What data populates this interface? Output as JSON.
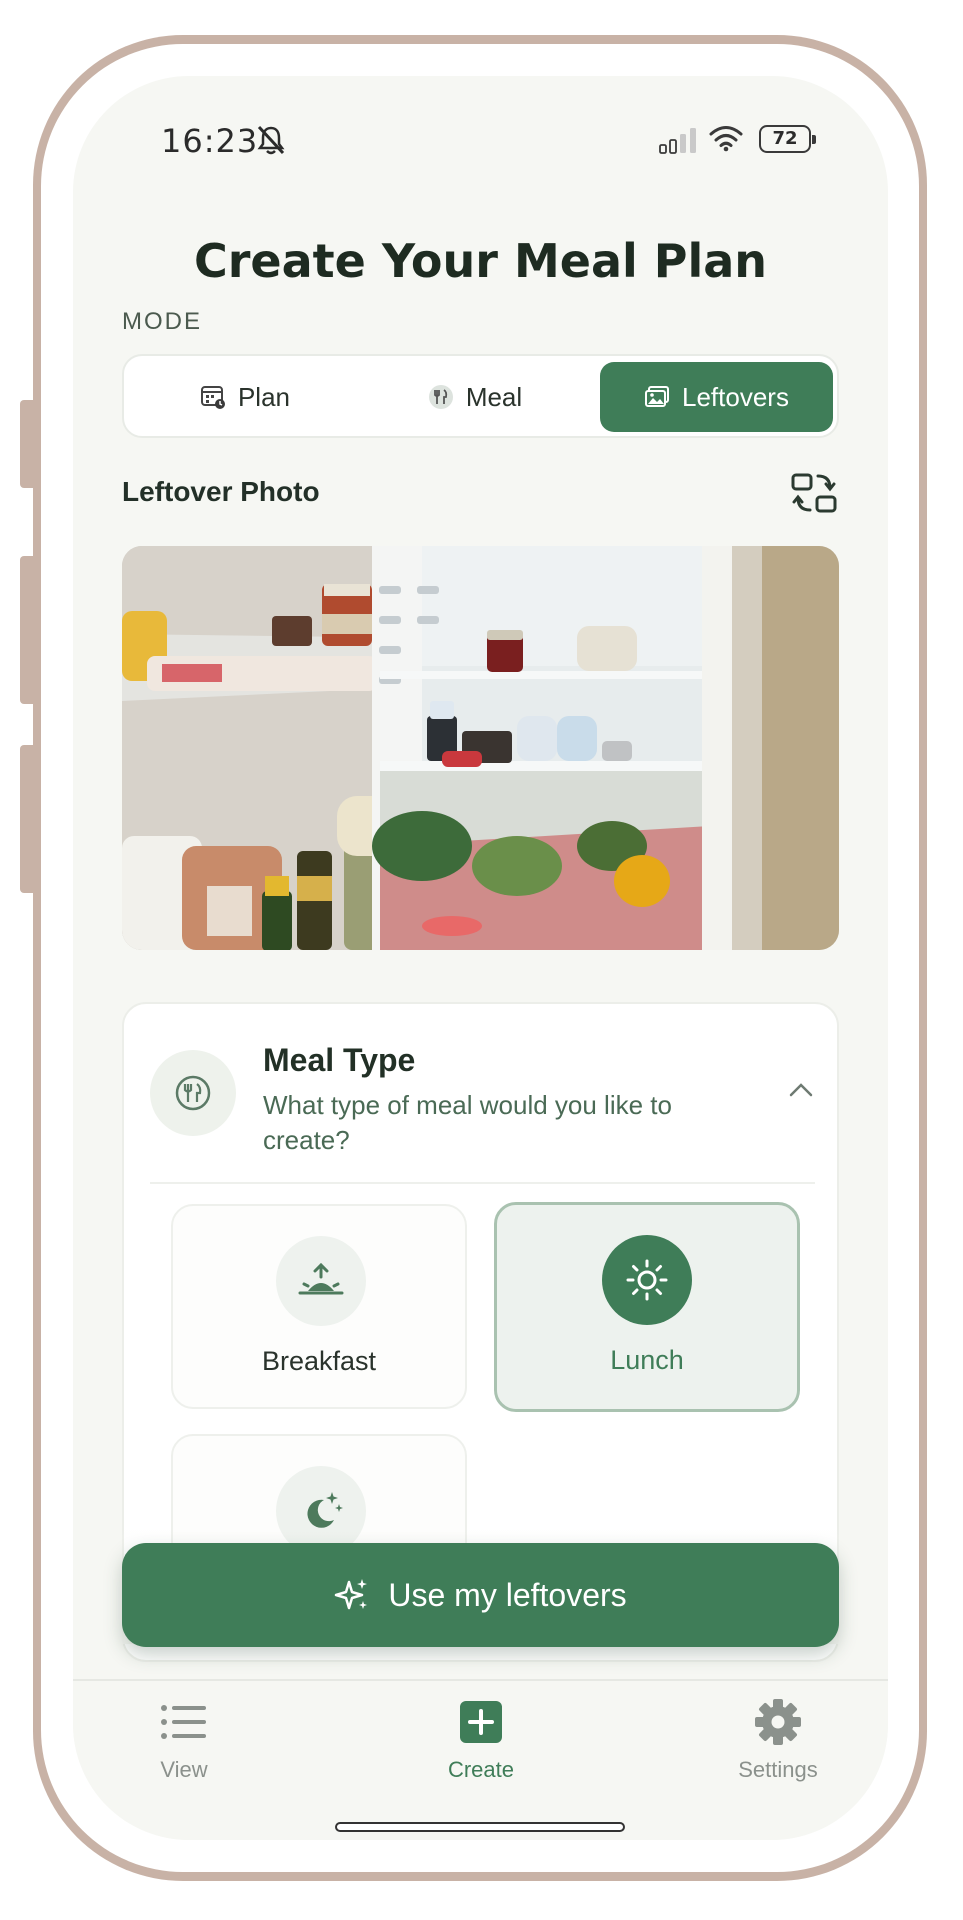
{
  "status_bar": {
    "time": "16:23",
    "battery": "72"
  },
  "page": {
    "title": "Create Your Meal Plan"
  },
  "mode": {
    "label": "MODE",
    "options": [
      {
        "label": "Plan",
        "icon": "calendar-icon",
        "active": false
      },
      {
        "label": "Meal",
        "icon": "utensils-icon",
        "active": false
      },
      {
        "label": "Leftovers",
        "icon": "photo-icon",
        "active": true
      }
    ]
  },
  "leftover_photo": {
    "title": "Leftover Photo",
    "swap_icon": "swap-camera-icon"
  },
  "meal_type": {
    "title": "Meal Type",
    "subtitle": "What type of meal would you like to create?",
    "expanded": true,
    "options": [
      {
        "label": "Breakfast",
        "icon": "sunrise-icon",
        "selected": false
      },
      {
        "label": "Lunch",
        "icon": "sun-icon",
        "selected": true
      },
      {
        "label": "",
        "icon": "moon-stars-icon",
        "selected": false
      }
    ]
  },
  "cta": {
    "label": "Use my leftovers",
    "icon": "sparkles-icon"
  },
  "tabbar": {
    "items": [
      {
        "label": "View",
        "icon": "list-icon",
        "active": false
      },
      {
        "label": "Create",
        "icon": "plus-square-icon",
        "active": true
      },
      {
        "label": "Settings",
        "icon": "gear-icon",
        "active": false
      }
    ]
  },
  "colors": {
    "accent": "#3f7d58",
    "frame": "#c8b2a6",
    "background": "#f6f7f3"
  }
}
